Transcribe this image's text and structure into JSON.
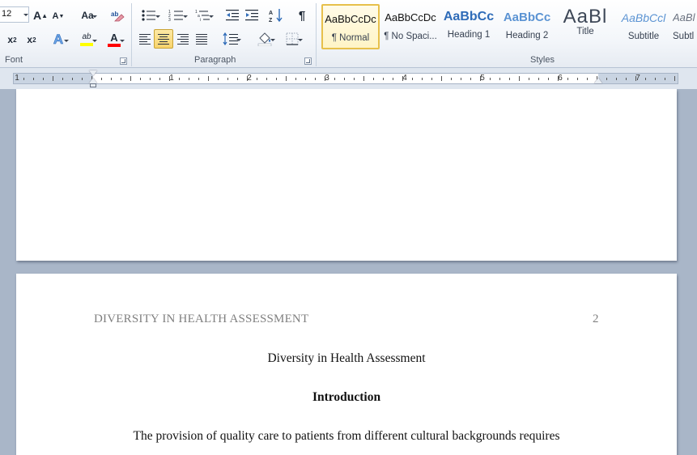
{
  "ribbon": {
    "font": {
      "size_value": "12",
      "group_label": "Font",
      "buttons": {
        "grow": "A",
        "shrink": "A",
        "change_case": "Aa",
        "subscript": "x",
        "superscript": "x",
        "text_effects": "A",
        "highlight": "ab",
        "font_color": "A"
      },
      "colors": {
        "highlight": "#ffff00",
        "font_color": "#ff0000"
      }
    },
    "paragraph": {
      "group_label": "Paragraph",
      "pilcrow": "¶",
      "sort": "A↓Z"
    },
    "styles": {
      "group_label": "Styles",
      "items": [
        {
          "sample": "AaBbCcDc",
          "name": "¶ Normal",
          "selected": true
        },
        {
          "sample": "AaBbCcDc",
          "name": "¶ No Spaci...",
          "selected": false
        },
        {
          "sample": "AaBbCc",
          "name": "Heading 1",
          "selected": false
        },
        {
          "sample": "AaBbCc",
          "name": "Heading 2",
          "selected": false
        },
        {
          "sample": "AaBl",
          "name": "Title",
          "selected": false
        },
        {
          "sample": "AaBbCcl",
          "name": "Subtitle",
          "selected": false
        },
        {
          "sample": "AaBl",
          "name": "Subtl",
          "selected": false
        }
      ]
    }
  },
  "ruler": {
    "numbers": [
      "1",
      "1",
      "2",
      "3",
      "4",
      "5",
      "6",
      "7"
    ]
  },
  "document": {
    "page2": {
      "running_head": "DIVERSITY IN HEALTH ASSESSMENT",
      "page_number": "2",
      "title": "Diversity in Health Assessment",
      "heading": "Introduction",
      "body_first_line": "The provision of quality care to patients from different cultural backgrounds requires"
    }
  }
}
